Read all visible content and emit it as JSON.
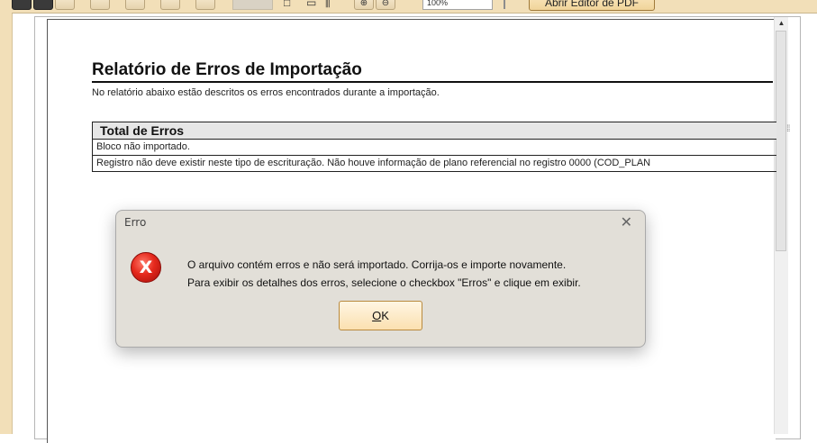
{
  "toolbar": {
    "zoom_value": "100%",
    "open_pdf_editor_label": "Abrir Editor de PDF"
  },
  "report": {
    "title": "Relatório de Erros de Importação",
    "description": "No relatório abaixo estão descritos os erros encontrados durante a importação.",
    "table_header": "Total de Erros",
    "rows": [
      "Bloco não importado.",
      "Registro não deve existir neste tipo de escrituração. Não houve informação de plano referencial no registro 0000 (COD_PLAN"
    ]
  },
  "dialog": {
    "title": "Erro",
    "close_glyph": "✕",
    "icon_glyph": "X",
    "message_line1": "O arquivo contém erros e não será importado. Corrija-os e importe novamente.",
    "message_line2": "Para exibir os detalhes dos erros, selecione o checkbox \"Erros\" e clique em exibir.",
    "ok_mnemonic": "O",
    "ok_rest": "K"
  },
  "colors": {
    "toolbar_bg": "#f2dfb8",
    "dialog_bg": "#e2dfd8",
    "error_red": "#e5281c"
  },
  "icons": [
    "save-icon",
    "print-icon",
    "zoom-in-icon",
    "zoom-out-icon",
    "error-icon",
    "close-icon"
  ]
}
